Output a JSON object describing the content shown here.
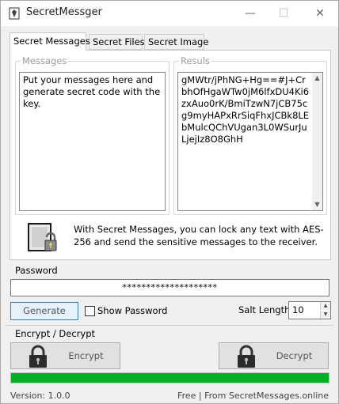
{
  "window": {
    "title": "SecretMessger"
  },
  "tabs": [
    {
      "label": "Secret Messages",
      "active": true
    },
    {
      "label": "Secret Files",
      "active": false
    },
    {
      "label": "Secret Image",
      "active": false
    }
  ],
  "messages": {
    "label": "Messages",
    "value": "Put your messages here and generate secret code with the key."
  },
  "results": {
    "label": "Resuls",
    "value": "gMWtr/jPhNG+Hg==#J+CrbhOfHgaWTw0jM6lfxDU4Ki6zxAuo0rK/BmiTzwN7jCB75cg9myHAPxRrSiqFhxJCBk8LEbMulcQChVUgan3L0WSurJuLjejIz8O8GhH"
  },
  "info": {
    "text": "With Secret Messages, you can lock any text with AES-256 and send the sensitive messages to the receiver."
  },
  "password": {
    "label": "Password",
    "value": "********************"
  },
  "generate": {
    "label": "Generate"
  },
  "show_password": {
    "label": "Show Password",
    "checked": false
  },
  "salt": {
    "label": "Salt Length:",
    "value": "10"
  },
  "encrypt_decrypt": {
    "label": "Encrypt / Decrypt",
    "encrypt_label": "Encrypt",
    "decrypt_label": "Decrypt",
    "progress": 1.0
  },
  "status": {
    "version": "Version: 1.0.0",
    "credit": "Free | From SecretMessages.online"
  },
  "colors": {
    "progress": "#06b025",
    "accent_border": "#3c7fb1"
  },
  "icons": [
    "app-icon",
    "minimize-icon",
    "maximize-icon",
    "close-icon",
    "file-lock-icon",
    "padlock-icon"
  ]
}
